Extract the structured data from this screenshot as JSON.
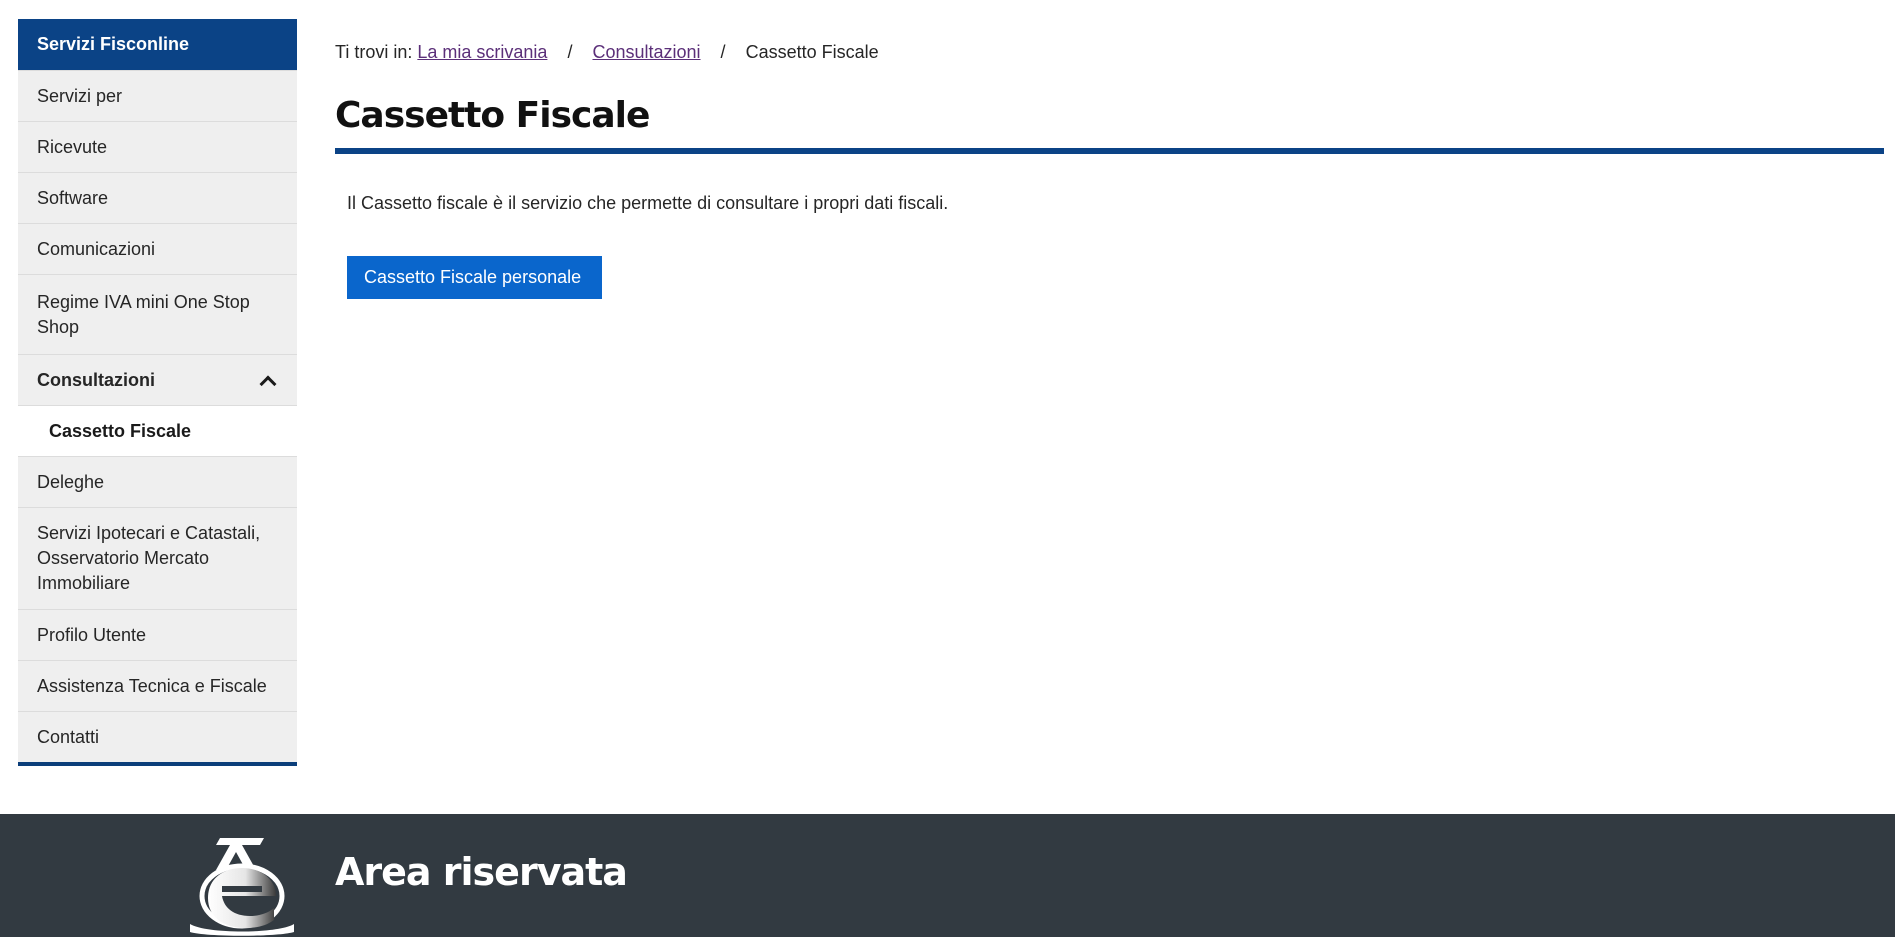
{
  "sidebar": {
    "header": "Servizi Fisconline",
    "items": [
      {
        "label": "Servizi per"
      },
      {
        "label": "Ricevute"
      },
      {
        "label": "Software"
      },
      {
        "label": "Comunicazioni"
      },
      {
        "label": "Regime IVA mini One Stop Shop"
      },
      {
        "label": "Consultazioni",
        "expanded": true
      },
      {
        "label": "Cassetto Fiscale",
        "active": true
      },
      {
        "label": "Deleghe"
      },
      {
        "label": "Servizi Ipotecari e Catastali, Osservatorio Mercato Immobiliare"
      },
      {
        "label": "Profilo Utente"
      },
      {
        "label": "Assistenza Tecnica e Fiscale"
      },
      {
        "label": "Contatti"
      }
    ]
  },
  "breadcrumb": {
    "prefix": "Ti trovi in:",
    "links": [
      "La mia scrivania",
      "Consultazioni"
    ],
    "separator": "/",
    "current": "Cassetto Fiscale"
  },
  "main": {
    "title": "Cassetto Fiscale",
    "description": "Il Cassetto fiscale è il servizio che permette di consultare i propri dati fiscali.",
    "button_label": "Cassetto Fiscale personale"
  },
  "footer": {
    "title": "Area riservata",
    "logo_icon": "agenzia-entrate-logo-icon"
  },
  "colors": {
    "brand_blue": "#0b4386",
    "button_blue": "#0a66cc",
    "visited_link": "#5b2f79",
    "footer_bg": "#323a41",
    "sidebar_bg": "#efefef"
  }
}
